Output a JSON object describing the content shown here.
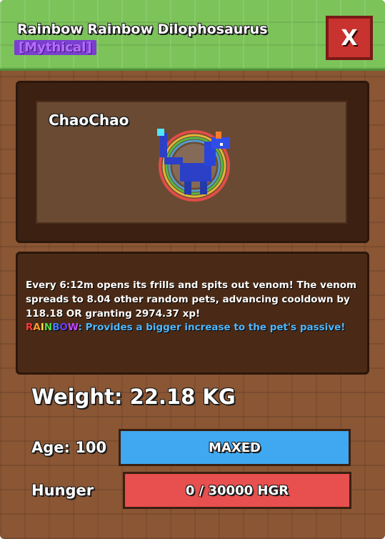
{
  "header": {
    "title": "Rainbow Rainbow Dilophosaurus",
    "rarity": "[Mythical]",
    "close_label": "X"
  },
  "pet": {
    "name": "ChaoChao"
  },
  "description": {
    "text": "Every 6:12m opens its frills and spits out venom! The venom spreads to 8.04 other random pets, advancing cooldown by 118.18 OR granting 2974.37 xp!",
    "rainbow_word": [
      "R",
      "A",
      "I",
      "N",
      "B",
      "O",
      "W"
    ],
    "rainbow_colon": ":",
    "rainbow_text": " Provides a bigger increase to the pet's passive!"
  },
  "stats": {
    "weight": "Weight: 22.18 KG",
    "age_label": "Age: 100",
    "age_bar_text": "MAXED",
    "age_fraction": 1.0,
    "hunger_label": "Hunger",
    "hunger_bar_text": "0 / 30000 HGR",
    "hunger_fraction": 0.0
  },
  "colors": {
    "age_bar": "#3fa8f0",
    "hunger_bar": "#e84f4f",
    "header_green": "#7cc35a",
    "close_red": "#c8332f"
  }
}
